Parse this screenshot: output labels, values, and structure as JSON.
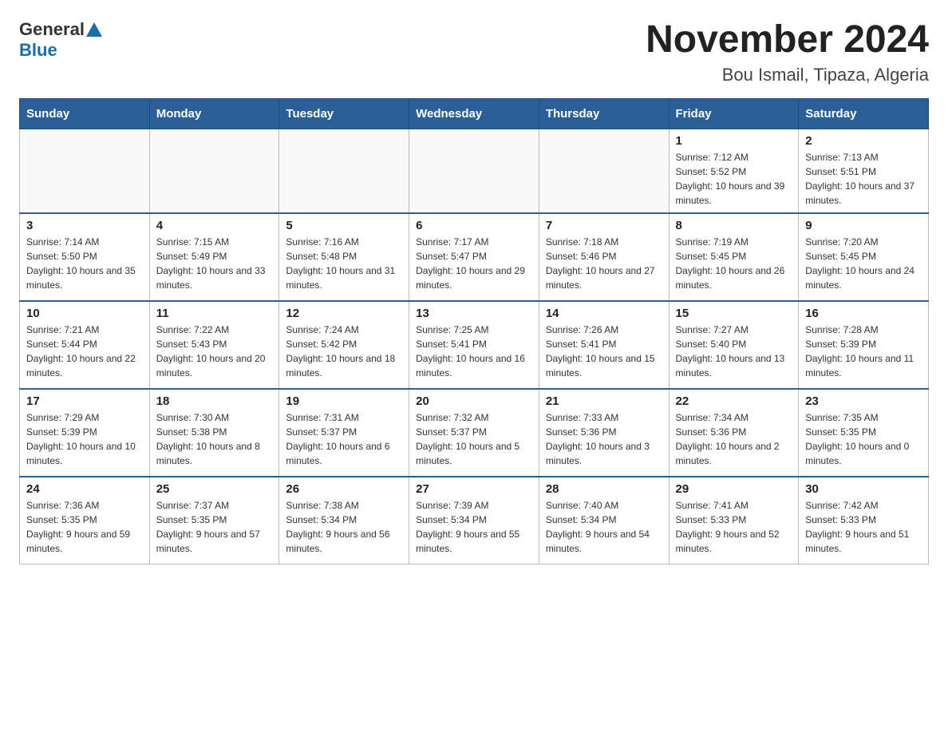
{
  "header": {
    "logo_general": "General",
    "logo_blue": "Blue",
    "title": "November 2024",
    "subtitle": "Bou Ismail, Tipaza, Algeria"
  },
  "weekdays": [
    "Sunday",
    "Monday",
    "Tuesday",
    "Wednesday",
    "Thursday",
    "Friday",
    "Saturday"
  ],
  "weeks": [
    [
      {
        "day": "",
        "info": ""
      },
      {
        "day": "",
        "info": ""
      },
      {
        "day": "",
        "info": ""
      },
      {
        "day": "",
        "info": ""
      },
      {
        "day": "",
        "info": ""
      },
      {
        "day": "1",
        "info": "Sunrise: 7:12 AM\nSunset: 5:52 PM\nDaylight: 10 hours and 39 minutes."
      },
      {
        "day": "2",
        "info": "Sunrise: 7:13 AM\nSunset: 5:51 PM\nDaylight: 10 hours and 37 minutes."
      }
    ],
    [
      {
        "day": "3",
        "info": "Sunrise: 7:14 AM\nSunset: 5:50 PM\nDaylight: 10 hours and 35 minutes."
      },
      {
        "day": "4",
        "info": "Sunrise: 7:15 AM\nSunset: 5:49 PM\nDaylight: 10 hours and 33 minutes."
      },
      {
        "day": "5",
        "info": "Sunrise: 7:16 AM\nSunset: 5:48 PM\nDaylight: 10 hours and 31 minutes."
      },
      {
        "day": "6",
        "info": "Sunrise: 7:17 AM\nSunset: 5:47 PM\nDaylight: 10 hours and 29 minutes."
      },
      {
        "day": "7",
        "info": "Sunrise: 7:18 AM\nSunset: 5:46 PM\nDaylight: 10 hours and 27 minutes."
      },
      {
        "day": "8",
        "info": "Sunrise: 7:19 AM\nSunset: 5:45 PM\nDaylight: 10 hours and 26 minutes."
      },
      {
        "day": "9",
        "info": "Sunrise: 7:20 AM\nSunset: 5:45 PM\nDaylight: 10 hours and 24 minutes."
      }
    ],
    [
      {
        "day": "10",
        "info": "Sunrise: 7:21 AM\nSunset: 5:44 PM\nDaylight: 10 hours and 22 minutes."
      },
      {
        "day": "11",
        "info": "Sunrise: 7:22 AM\nSunset: 5:43 PM\nDaylight: 10 hours and 20 minutes."
      },
      {
        "day": "12",
        "info": "Sunrise: 7:24 AM\nSunset: 5:42 PM\nDaylight: 10 hours and 18 minutes."
      },
      {
        "day": "13",
        "info": "Sunrise: 7:25 AM\nSunset: 5:41 PM\nDaylight: 10 hours and 16 minutes."
      },
      {
        "day": "14",
        "info": "Sunrise: 7:26 AM\nSunset: 5:41 PM\nDaylight: 10 hours and 15 minutes."
      },
      {
        "day": "15",
        "info": "Sunrise: 7:27 AM\nSunset: 5:40 PM\nDaylight: 10 hours and 13 minutes."
      },
      {
        "day": "16",
        "info": "Sunrise: 7:28 AM\nSunset: 5:39 PM\nDaylight: 10 hours and 11 minutes."
      }
    ],
    [
      {
        "day": "17",
        "info": "Sunrise: 7:29 AM\nSunset: 5:39 PM\nDaylight: 10 hours and 10 minutes."
      },
      {
        "day": "18",
        "info": "Sunrise: 7:30 AM\nSunset: 5:38 PM\nDaylight: 10 hours and 8 minutes."
      },
      {
        "day": "19",
        "info": "Sunrise: 7:31 AM\nSunset: 5:37 PM\nDaylight: 10 hours and 6 minutes."
      },
      {
        "day": "20",
        "info": "Sunrise: 7:32 AM\nSunset: 5:37 PM\nDaylight: 10 hours and 5 minutes."
      },
      {
        "day": "21",
        "info": "Sunrise: 7:33 AM\nSunset: 5:36 PM\nDaylight: 10 hours and 3 minutes."
      },
      {
        "day": "22",
        "info": "Sunrise: 7:34 AM\nSunset: 5:36 PM\nDaylight: 10 hours and 2 minutes."
      },
      {
        "day": "23",
        "info": "Sunrise: 7:35 AM\nSunset: 5:35 PM\nDaylight: 10 hours and 0 minutes."
      }
    ],
    [
      {
        "day": "24",
        "info": "Sunrise: 7:36 AM\nSunset: 5:35 PM\nDaylight: 9 hours and 59 minutes."
      },
      {
        "day": "25",
        "info": "Sunrise: 7:37 AM\nSunset: 5:35 PM\nDaylight: 9 hours and 57 minutes."
      },
      {
        "day": "26",
        "info": "Sunrise: 7:38 AM\nSunset: 5:34 PM\nDaylight: 9 hours and 56 minutes."
      },
      {
        "day": "27",
        "info": "Sunrise: 7:39 AM\nSunset: 5:34 PM\nDaylight: 9 hours and 55 minutes."
      },
      {
        "day": "28",
        "info": "Sunrise: 7:40 AM\nSunset: 5:34 PM\nDaylight: 9 hours and 54 minutes."
      },
      {
        "day": "29",
        "info": "Sunrise: 7:41 AM\nSunset: 5:33 PM\nDaylight: 9 hours and 52 minutes."
      },
      {
        "day": "30",
        "info": "Sunrise: 7:42 AM\nSunset: 5:33 PM\nDaylight: 9 hours and 51 minutes."
      }
    ]
  ]
}
